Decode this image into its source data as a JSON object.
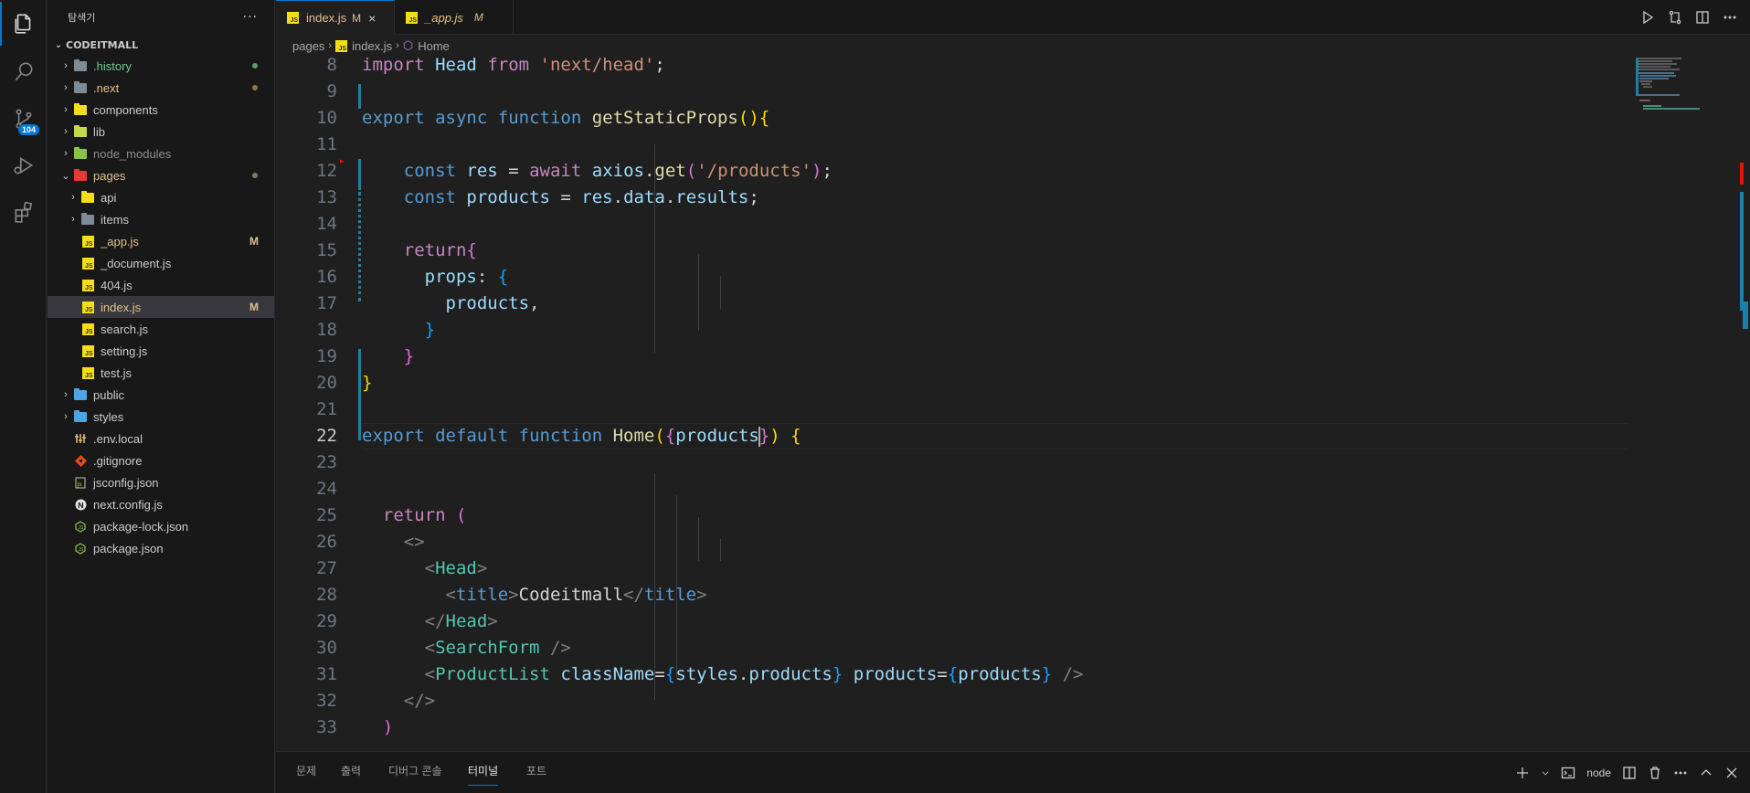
{
  "explorer": {
    "title": "탐색기",
    "more": "···",
    "root": "CODEITMALL",
    "items": [
      {
        "label": ".history",
        "color": "#73c991",
        "dot": "#5d9b6a",
        "kind": "folder",
        "chev": "›"
      },
      {
        "label": ".next",
        "color": "#e2c08d",
        "dot": "#8a7a5a",
        "kind": "folder",
        "chev": "›"
      },
      {
        "label": "components",
        "color": "#cccccc",
        "kind": "folder",
        "chev": "›"
      },
      {
        "label": "lib",
        "color": "#cccccc",
        "kind": "folder",
        "chev": "›"
      },
      {
        "label": "node_modules",
        "color": "#8c8c8c",
        "kind": "folder",
        "chev": "›"
      },
      {
        "label": "pages",
        "color": "#e2c08d",
        "dot": "#8a7a5a",
        "kind": "folder",
        "chev": "⌄"
      },
      {
        "label": "api",
        "color": "#cccccc",
        "kind": "folder",
        "chev": "›"
      },
      {
        "label": "items",
        "color": "#cccccc",
        "kind": "folder",
        "chev": "›"
      },
      {
        "label": "_app.js",
        "color": "#e2c08d",
        "mod": "M",
        "kind": "js"
      },
      {
        "label": "_document.js",
        "color": "#cccccc",
        "kind": "js"
      },
      {
        "label": "404.js",
        "color": "#cccccc",
        "kind": "js"
      },
      {
        "label": "index.js",
        "color": "#e2c08d",
        "mod": "M",
        "kind": "js"
      },
      {
        "label": "search.js",
        "color": "#cccccc",
        "kind": "js"
      },
      {
        "label": "setting.js",
        "color": "#cccccc",
        "kind": "js"
      },
      {
        "label": "test.js",
        "color": "#cccccc",
        "kind": "js"
      },
      {
        "label": "public",
        "color": "#cccccc",
        "kind": "folder",
        "chev": "›"
      },
      {
        "label": "styles",
        "color": "#cccccc",
        "kind": "folder",
        "chev": "›"
      },
      {
        "label": ".env.local",
        "color": "#cccccc",
        "kind": "env"
      },
      {
        "label": ".gitignore",
        "color": "#cccccc",
        "kind": "git"
      },
      {
        "label": "jsconfig.json",
        "color": "#cccccc",
        "kind": "jsconfig"
      },
      {
        "label": "next.config.js",
        "color": "#cccccc",
        "kind": "next"
      },
      {
        "label": "package-lock.json",
        "color": "#cccccc",
        "kind": "pkg"
      },
      {
        "label": "package.json",
        "color": "#cccccc",
        "kind": "pkg"
      }
    ]
  },
  "activity": {
    "source_control_badge": "104"
  },
  "tabs": [
    {
      "label": "index.js",
      "mod": "M",
      "close": "×"
    },
    {
      "label": "_app.js",
      "mod": "M"
    }
  ],
  "breadcrumb": {
    "folder": "pages",
    "file": "index.js",
    "symbol": "Home",
    "sep": "›"
  },
  "editor": {
    "lines": [
      8,
      9,
      10,
      11,
      12,
      13,
      14,
      15,
      16,
      17,
      18,
      19,
      20,
      21,
      22,
      23,
      24,
      25,
      26,
      27,
      28,
      29,
      30,
      31,
      32,
      33
    ],
    "current_line": 22,
    "code": {
      "l8_import": "import",
      "l8_head": "Head",
      "l8_from": "from",
      "l8_str": "'next/head'",
      "l8_semi": ";",
      "export": "export",
      "async": "async",
      "function": "function",
      "getStaticProps": "getStaticProps",
      "const": "const",
      "res": "res",
      "await": "await",
      "axios": "axios",
      "get": "get",
      "products_url": "'/products'",
      "products": "products",
      "data": "data",
      "results": "results",
      "return": "return",
      "props": "props",
      "default": "default",
      "Home": "Home",
      "Head": "Head",
      "title": "title",
      "title_text": "Codeitmall",
      "SearchForm": "SearchForm",
      "ProductList": "ProductList",
      "className": "className",
      "styles": "styles"
    }
  },
  "panel": {
    "tabs": [
      "문제",
      "출력",
      "디버그 콘솔",
      "터미널",
      "포트"
    ],
    "active_tab": "터미널",
    "terminal_name": "node"
  }
}
